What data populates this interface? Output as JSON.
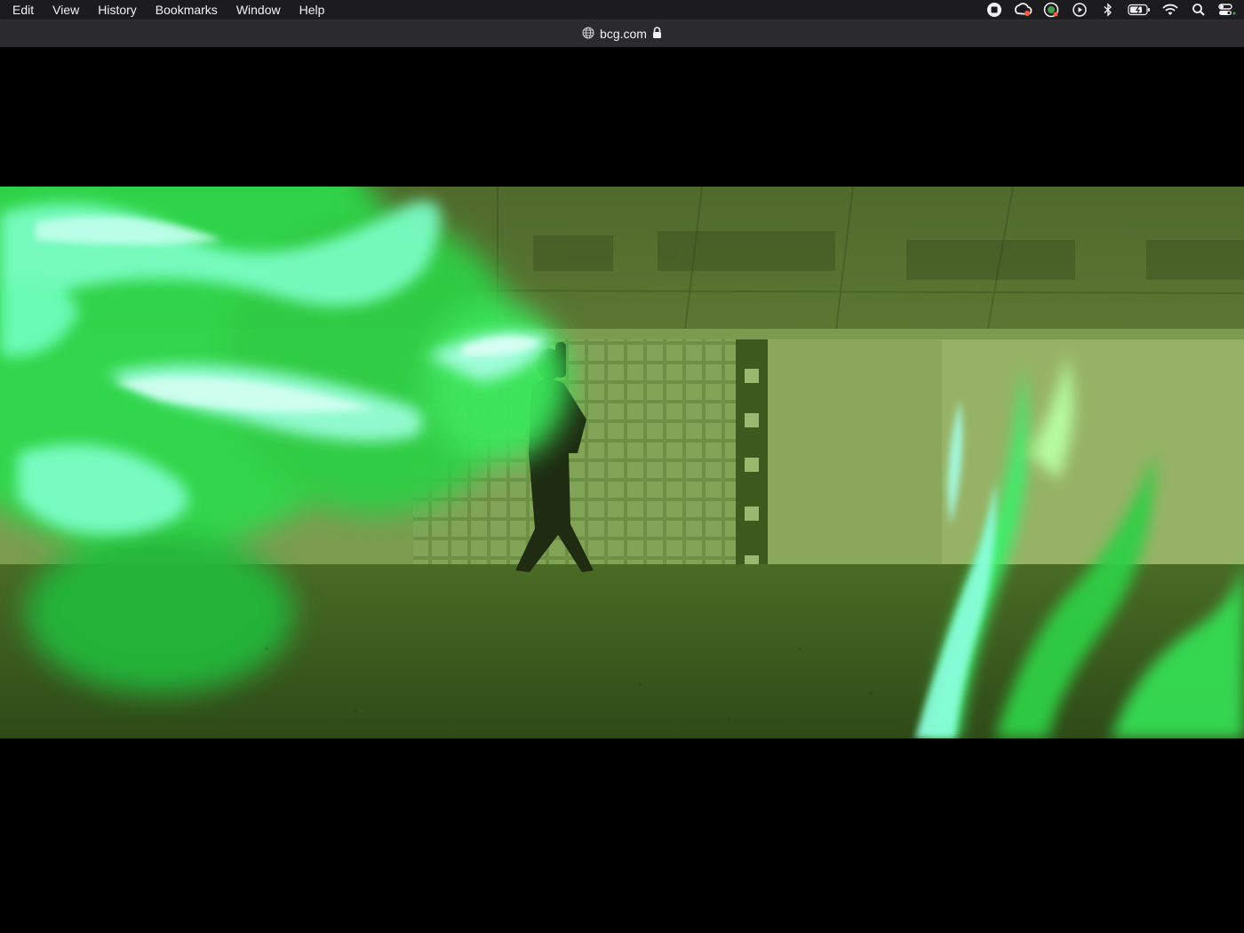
{
  "menubar": {
    "items": [
      {
        "label": "Edit"
      },
      {
        "label": "View"
      },
      {
        "label": "History"
      },
      {
        "label": "Bookmarks"
      },
      {
        "label": "Window"
      },
      {
        "label": "Help"
      }
    ],
    "status_icons": [
      "stop-record-icon",
      "creative-cloud-icon",
      "app-status-icon",
      "play-circle-icon",
      "bluetooth-icon",
      "battery-icon",
      "wifi-icon",
      "spotlight-search-icon",
      "control-center-icon"
    ]
  },
  "addressbar": {
    "url": "bcg.com",
    "site_icon": "globe-icon",
    "lock_icon": "lock-icon"
  },
  "video": {
    "description_icon": "video-frame",
    "tint": "#3f5c1e",
    "glow": "#4dff6a",
    "highlight": "#8dffe0"
  }
}
